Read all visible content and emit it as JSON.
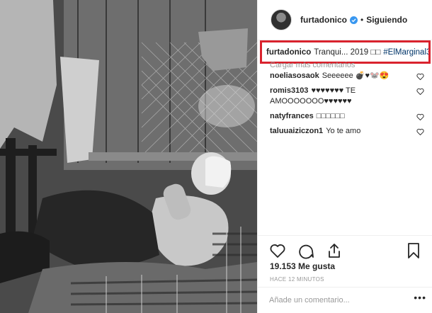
{
  "post": {
    "username": "furtadonico",
    "follow_status": "Siguiendo",
    "separator": "•",
    "caption": {
      "username": "furtadonico",
      "text": "Tranqui... 2019 □□",
      "hashtag": "#ElMarginal3"
    },
    "load_more": "Cargar más comentarios",
    "comments": [
      {
        "user": "noeliasosaok",
        "text": "Seeeeee 💣♥🐭😍"
      },
      {
        "user": "romis3103",
        "text": "♥♥♥♥♥♥♥ TE AMOOOOOOO♥♥♥♥♥♥"
      },
      {
        "user": "natyfrances",
        "text": "□□□□□□"
      },
      {
        "user": "taluuaiziczon1",
        "text": "Yo te amo"
      }
    ],
    "likes": "19.153 Me gusta",
    "time": "HACE 12 MINUTOS",
    "add_comment_placeholder": "Añade un comentario...",
    "more": "•••"
  },
  "colors": {
    "highlight_border": "#d9232e",
    "hashtag": "#003569",
    "verified": "#3897f0"
  },
  "icons": {
    "like": "heart-icon",
    "comment": "comment-icon",
    "share": "share-icon",
    "save": "bookmark-icon",
    "verified": "verified-badge-icon"
  }
}
